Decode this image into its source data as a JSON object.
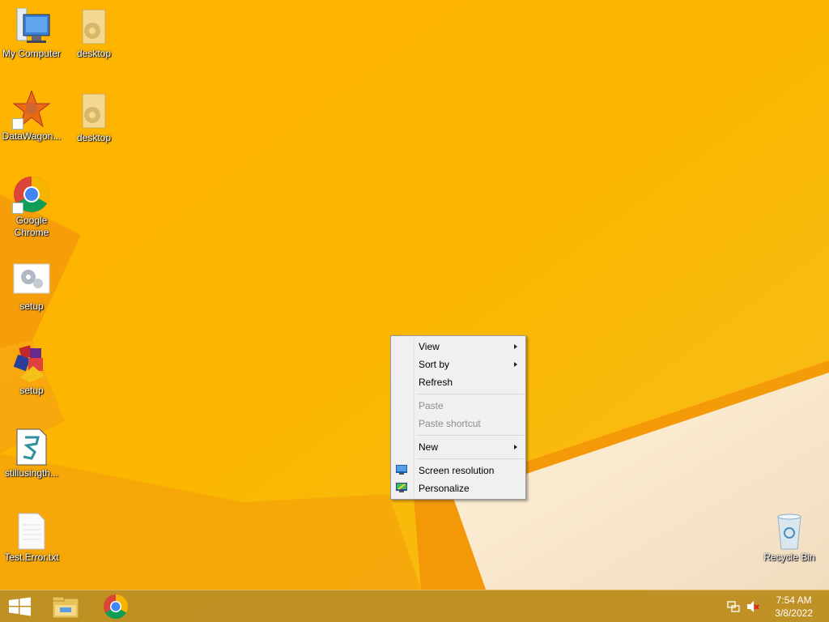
{
  "desktop": {
    "icons": [
      {
        "label": "My Computer",
        "kind": "computer-icon"
      },
      {
        "label": "desktop",
        "kind": "settings-file-icon"
      },
      {
        "label": "DataWagon...",
        "kind": "datawagon-icon"
      },
      {
        "label": "desktop",
        "kind": "settings-file-icon"
      },
      {
        "label": "Google Chrome",
        "kind": "chrome-icon"
      },
      {
        "label": "setup",
        "kind": "setup-gear-icon"
      },
      {
        "label": "setup",
        "kind": "setup-installer-icon"
      },
      {
        "label": "stillusingth...",
        "kind": "script-file-icon"
      },
      {
        "label": "Test.Error.txt",
        "kind": "text-file-icon"
      },
      {
        "label": "Recycle Bin",
        "kind": "recycle-bin-icon"
      }
    ]
  },
  "context_menu": {
    "view": "View",
    "sort_by": "Sort by",
    "refresh": "Refresh",
    "paste": "Paste",
    "paste_shortcut": "Paste shortcut",
    "new": "New",
    "screen_resolution": "Screen resolution",
    "personalize": "Personalize"
  },
  "taskbar": {
    "time": "7:54 AM",
    "date": "3/8/2022"
  },
  "colors": {
    "wallpaper": "#f8b100",
    "taskbar": "#b68b28",
    "menu_bg": "#f0f0f0"
  }
}
